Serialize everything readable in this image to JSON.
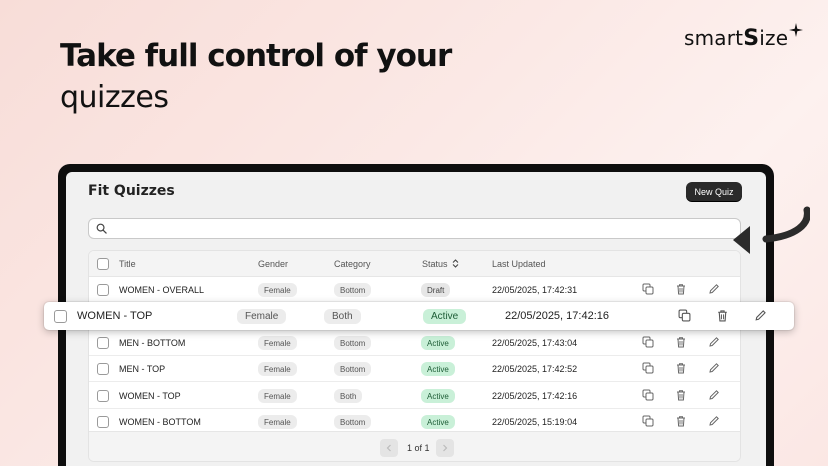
{
  "hero": {
    "title": "Take full control of your",
    "subtitle": "quizzes"
  },
  "brand": {
    "prefix": "smart",
    "big_letter": "S",
    "suffix": "ize"
  },
  "page": {
    "title": "Fit Quizzes",
    "new_button": "New Quiz"
  },
  "table": {
    "headers": {
      "title": "Title",
      "gender": "Gender",
      "category": "Category",
      "status": "Status",
      "updated": "Last Updated"
    },
    "rows": [
      {
        "title": "WOMEN - OVERALL",
        "gender": "Female",
        "category": "Bottom",
        "status": "Draft",
        "updated": "22/05/2025, 17:42:31"
      },
      {
        "title": "MEN - BOTTOM",
        "gender": "Female",
        "category": "Bottom",
        "status": "Active",
        "updated": "22/05/2025, 17:43:04"
      },
      {
        "title": "MEN - TOP",
        "gender": "Female",
        "category": "Bottom",
        "status": "Active",
        "updated": "22/05/2025, 17:42:52"
      },
      {
        "title": "WOMEN - TOP",
        "gender": "Female",
        "category": "Both",
        "status": "Active",
        "updated": "22/05/2025, 17:42:16"
      },
      {
        "title": "WOMEN - BOTTOM",
        "gender": "Female",
        "category": "Bottom",
        "status": "Active",
        "updated": "22/05/2025, 15:19:04"
      }
    ]
  },
  "dragged_row": {
    "title": "WOMEN - TOP",
    "gender": "Female",
    "category": "Both",
    "status": "Active",
    "updated": "22/05/2025, 17:42:16"
  },
  "pagination": {
    "label": "1 of 1"
  },
  "colors": {
    "active_bg": "#c9f0d8",
    "active_text": "#1d5d36",
    "accent_dark": "#2a2a2a"
  }
}
